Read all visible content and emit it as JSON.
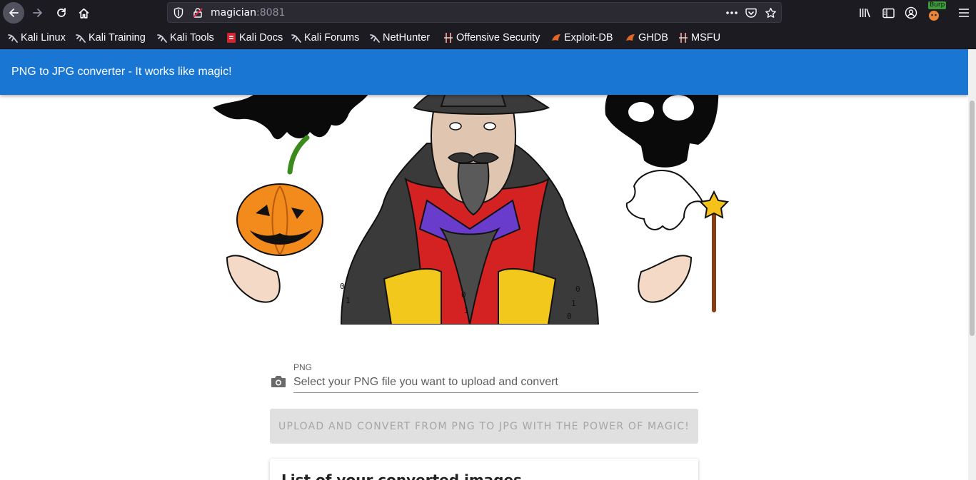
{
  "browser": {
    "url_host": "magician",
    "url_port": ":8081",
    "extension_badge": "Burp",
    "bookmarks": [
      {
        "label": "Kali Linux",
        "icon": "kali-dragon-icon"
      },
      {
        "label": "Kali Training",
        "icon": "kali-dragon-icon"
      },
      {
        "label": "Kali Tools",
        "icon": "kali-dragon-icon"
      },
      {
        "label": "Kali Docs",
        "icon": "kali-docs-icon"
      },
      {
        "label": "Kali Forums",
        "icon": "kali-dragon-icon"
      },
      {
        "label": "NetHunter",
        "icon": "kali-dragon-icon"
      },
      {
        "label": "Offensive Security",
        "icon": "offsec-icon"
      },
      {
        "label": "Exploit-DB",
        "icon": "exploitdb-icon"
      },
      {
        "label": "GHDB",
        "icon": "exploitdb-icon"
      },
      {
        "label": "MSFU",
        "icon": "offsec-icon"
      }
    ]
  },
  "app": {
    "title": "PNG to JPG converter - It works like magic!"
  },
  "upload": {
    "field_label": "PNG",
    "placeholder": "Select your PNG file you want to upload and convert",
    "button_label": "UPLOAD AND CONVERT FROM PNG TO JPG WITH THE POWER OF MAGIC!"
  },
  "list": {
    "title": "List of your converted images"
  },
  "illustration": {
    "binary_digits": [
      "0",
      "1",
      "0",
      "1",
      "0",
      "1",
      "0"
    ]
  },
  "colors": {
    "appbar": "#1976d2",
    "browser_chrome": "#1c1b22"
  }
}
